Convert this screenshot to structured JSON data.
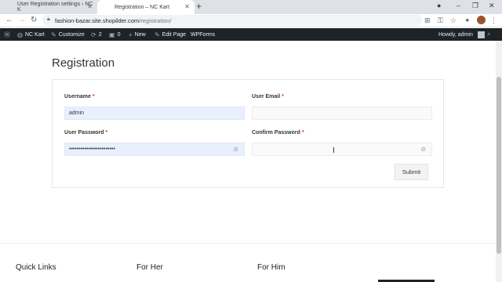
{
  "browser": {
    "tabs": [
      {
        "title": "User Registration settings ‹ NC K"
      },
      {
        "title": "Registration – NC Kart"
      }
    ],
    "url_host": "fashion-bazar.site.shopilder.com",
    "url_path": "/registration/"
  },
  "adminbar": {
    "site": "NC Kart",
    "customize": "Customize",
    "updates": "2",
    "comments": "0",
    "new": "New",
    "edit": "Edit Page",
    "forms": "WPForms",
    "howdy": "Howdy, admin"
  },
  "page": {
    "title": "Registration"
  },
  "form": {
    "username_label": "Username",
    "username_value": "admin",
    "email_label": "User Email",
    "email_value": "",
    "password_label": "User Password",
    "password_value": "••••••••••••••••••••••••",
    "confirm_label": "Confirm Password",
    "confirm_value": "",
    "required_mark": "*",
    "submit_label": "Submit"
  },
  "footer": {
    "col1": "Quick Links",
    "col2": "For Her",
    "col3": "For Him"
  },
  "icons": {
    "close": "close-icon",
    "new_tab": "plus-icon",
    "back": "back-arrow-icon",
    "forward": "forward-arrow-icon",
    "reload": "reload-icon",
    "lock": "lock-icon",
    "eye_off": "eye-off-icon"
  }
}
